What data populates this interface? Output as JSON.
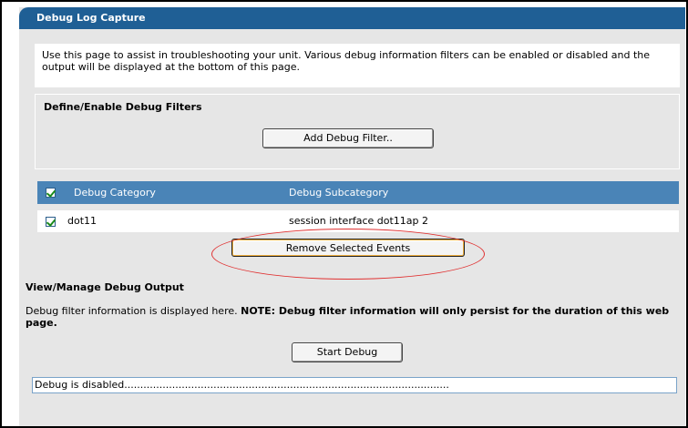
{
  "header": {
    "title": "Debug Log Capture"
  },
  "intro": {
    "text": "Use this page to assist in troubleshooting your unit. Various debug information filters can be enabled or disabled and the output will be displayed at the bottom of this page."
  },
  "filters": {
    "title": "Define/Enable Debug Filters",
    "add_button": "Add Debug Filter..",
    "columns": {
      "category": "Debug Category",
      "subcategory": "Debug Subcategory"
    },
    "rows": [
      {
        "category": "dot11",
        "subcategory": "session interface dot11ap 2",
        "checked": true
      }
    ],
    "remove_button": "Remove Selected Events"
  },
  "output": {
    "title": "View/Manage Debug Output",
    "description_prefix": "Debug filter information is displayed here. ",
    "description_note": "NOTE: Debug filter information will only persist for the duration of this web page.",
    "start_button": "Start Debug",
    "status_text": "Debug is disabled......................................................................................................"
  },
  "colors": {
    "header": "#1f5f95",
    "table_header": "#4a84b7",
    "panel": "#e6e6e6",
    "highlight_oval": "#e03030"
  }
}
